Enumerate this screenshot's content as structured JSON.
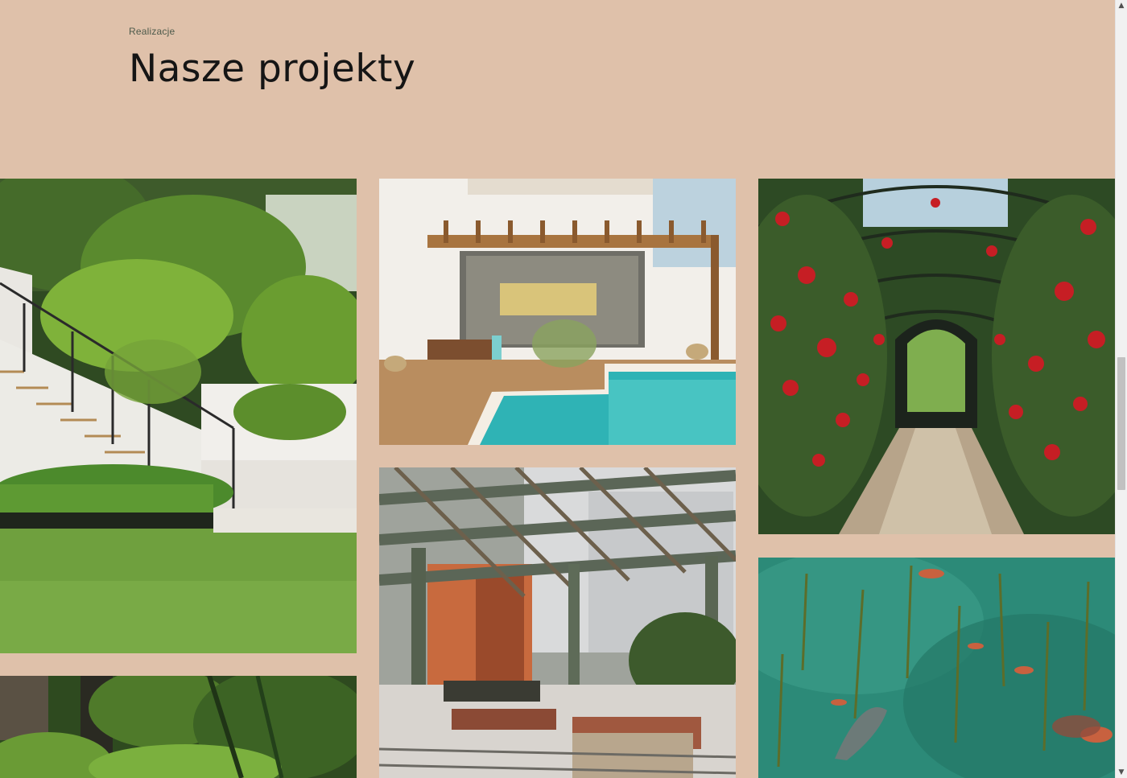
{
  "section": {
    "eyebrow": "Realizacje",
    "title": "Nasze projekty"
  },
  "gallery": {
    "images": [
      {
        "subject": "tropical garden with white staircase, glass railing and lawn"
      },
      {
        "subject": "palm trees and tropical foliage"
      },
      {
        "subject": "courtyard with wooden pergola and turquoise pool"
      },
      {
        "subject": "wooden pergola over terrace with benches"
      },
      {
        "subject": "rose-covered arched pergola tunnel with path"
      },
      {
        "subject": "green pond with water lilies and koi fish"
      }
    ]
  },
  "scrollbar": {
    "up_arrow": "▲",
    "down_arrow": "▼"
  },
  "colors": {
    "background": "#dfc1aa",
    "title": "#151515",
    "eyebrow": "#4d5a4b"
  }
}
